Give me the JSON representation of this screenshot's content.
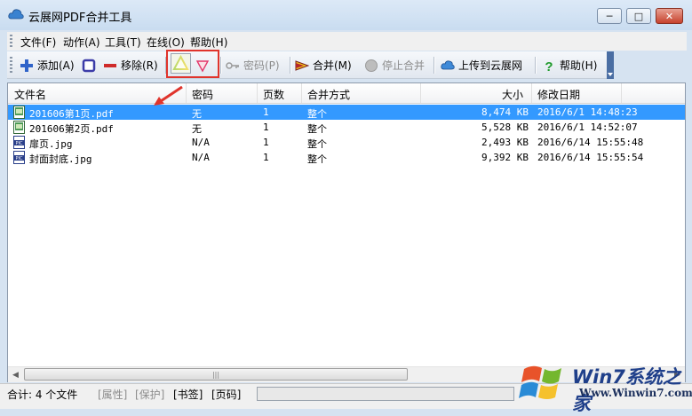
{
  "window": {
    "title": "云展网PDF合并工具",
    "buttons": {
      "minimize": "─",
      "maximize": "□",
      "close": "✕"
    }
  },
  "menu": [
    "文件(F)",
    "动作(A)",
    "工具(T)",
    "在线(O)",
    "帮助(H)"
  ],
  "toolbar": {
    "add": "添加(A)",
    "remove": "移除(R)",
    "password": "密码(P)",
    "merge": "合并(M)",
    "stop_merge": "停止合并",
    "upload": "上传到云展网",
    "help": "帮助(H)"
  },
  "list": {
    "columns": [
      "文件名",
      "密码",
      "页数",
      "合并方式",
      "大小",
      "修改日期"
    ],
    "rows": [
      {
        "name": "201606第1页.pdf",
        "password": "无",
        "pages": "1",
        "mode": "整个",
        "size": "8,474 KB",
        "date": "2016/6/1 14:48:23",
        "type": "pdf",
        "selected": true
      },
      {
        "name": "201606第2页.pdf",
        "password": "无",
        "pages": "1",
        "mode": "整个",
        "size": "5,528 KB",
        "date": "2016/6/1 14:52:07",
        "type": "pdf",
        "selected": false
      },
      {
        "name": "扉页.jpg",
        "password": "N/A",
        "pages": "1",
        "mode": "整个",
        "size": "2,493 KB",
        "date": "2016/6/14 15:55:48",
        "type": "jpg",
        "selected": false
      },
      {
        "name": "封面封底.jpg",
        "password": "N/A",
        "pages": "1",
        "mode": "整个",
        "size": "9,392 KB",
        "date": "2016/6/14 15:55:54",
        "type": "jpg",
        "selected": false
      }
    ]
  },
  "status": {
    "count": "合计: 4 个文件",
    "tags": [
      "[属性]",
      "[保护]",
      "[书签]",
      "[页码]"
    ]
  },
  "watermark": {
    "brand": "Win7系统之家",
    "url": "Www.Winwin7.com"
  },
  "colors": {
    "highlight": "#e0342c",
    "selection": "#3399ff"
  }
}
